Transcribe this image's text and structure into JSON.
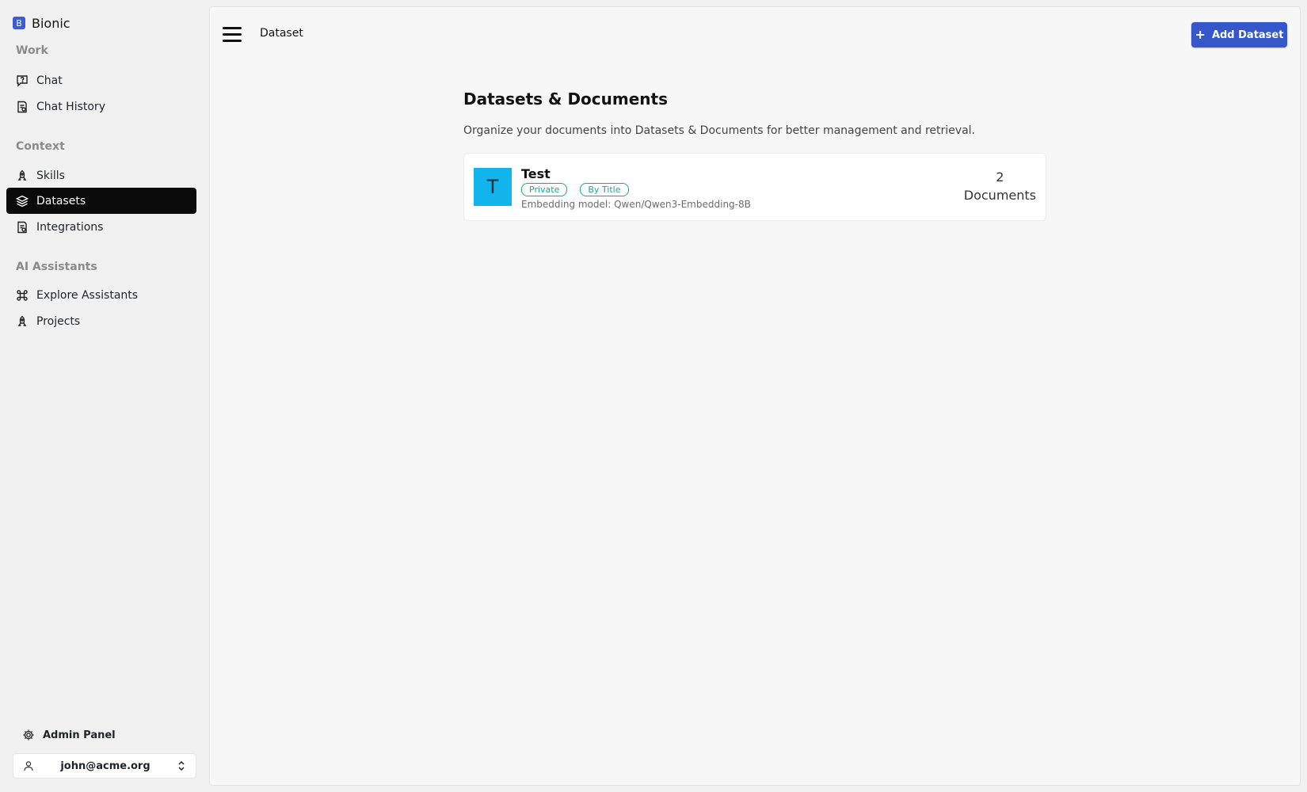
{
  "app": {
    "logo_letter": "B",
    "name": "Bionic"
  },
  "sidebar": {
    "sections": {
      "work": "Work",
      "context": "Context",
      "ai_assistants": "AI Assistants"
    },
    "items": [
      {
        "label": "Chat",
        "icon": "chat-question-icon"
      },
      {
        "label": "Chat History",
        "icon": "history-doc-icon"
      },
      {
        "label": "Skills",
        "icon": "rocket-icon"
      },
      {
        "label": "Datasets",
        "icon": "layers-icon",
        "active": true
      },
      {
        "label": "Integrations",
        "icon": "integrations-doc-icon"
      },
      {
        "label": "Explore Assistants",
        "icon": "command-icon"
      },
      {
        "label": "Projects",
        "icon": "rocket-icon"
      }
    ],
    "admin_panel": "Admin Panel",
    "user_email": "john@acme.org"
  },
  "topbar": {
    "title": "Dataset",
    "add_button": "Add Dataset"
  },
  "page": {
    "title": "Datasets & Documents",
    "description": "Organize your documents into Datasets & Documents for better management and retrieval."
  },
  "datasets": [
    {
      "avatar_letter": "T",
      "name": "Test",
      "badges": [
        "Private",
        "By Title"
      ],
      "embedding": "Embedding model: Qwen/Qwen3-Embedding-8B",
      "count": "2",
      "count_label": "Documents"
    }
  ],
  "colors": {
    "accent": "#3557c9",
    "active_nav": "#0a0a0a",
    "avatar_bg": "#12b4ec",
    "badge": "#1aa79a"
  }
}
